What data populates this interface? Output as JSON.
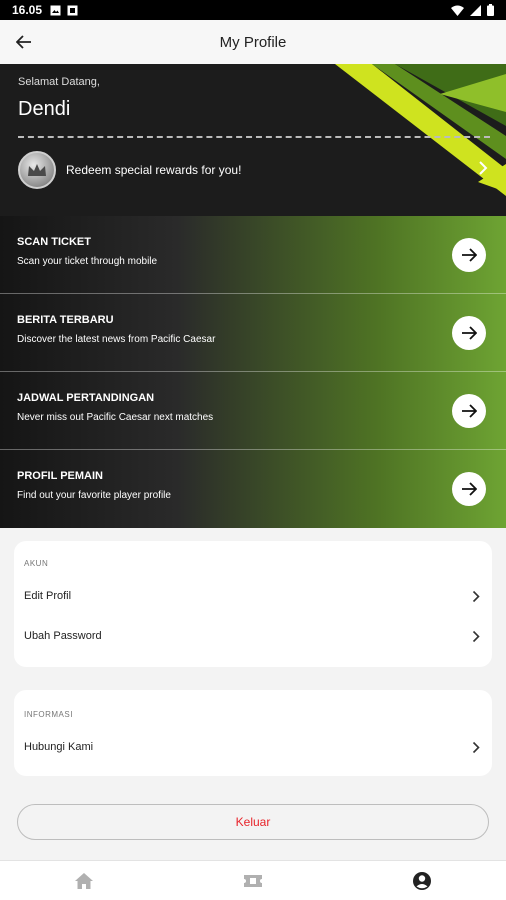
{
  "status_bar": {
    "time": "16.05"
  },
  "app_bar": {
    "title": "My Profile"
  },
  "hero": {
    "welcome_label": "Selamat Datang,",
    "user_name": "Dendi",
    "reward_text": "Redeem special rewards for you!"
  },
  "menu": [
    {
      "title": "SCAN TICKET",
      "subtitle": "Scan your ticket through mobile"
    },
    {
      "title": "BERITA TERBARU",
      "subtitle": "Discover the latest news from Pacific Caesar"
    },
    {
      "title": "JADWAL PERTANDINGAN",
      "subtitle": "Never miss out Pacific Caesar next matches"
    },
    {
      "title": "PROFIL PEMAIN",
      "subtitle": "Find out your favorite player profile"
    }
  ],
  "account": {
    "label": "AKUN",
    "items": [
      "Edit Profil",
      "Ubah Password"
    ]
  },
  "info": {
    "label": "INFORMASI",
    "items": [
      "Hubungi Kami"
    ]
  },
  "logout_label": "Keluar",
  "colors": {
    "accent_green": "#6ea433",
    "logout_red": "#e8232a",
    "dark": "#1c1c1c"
  }
}
